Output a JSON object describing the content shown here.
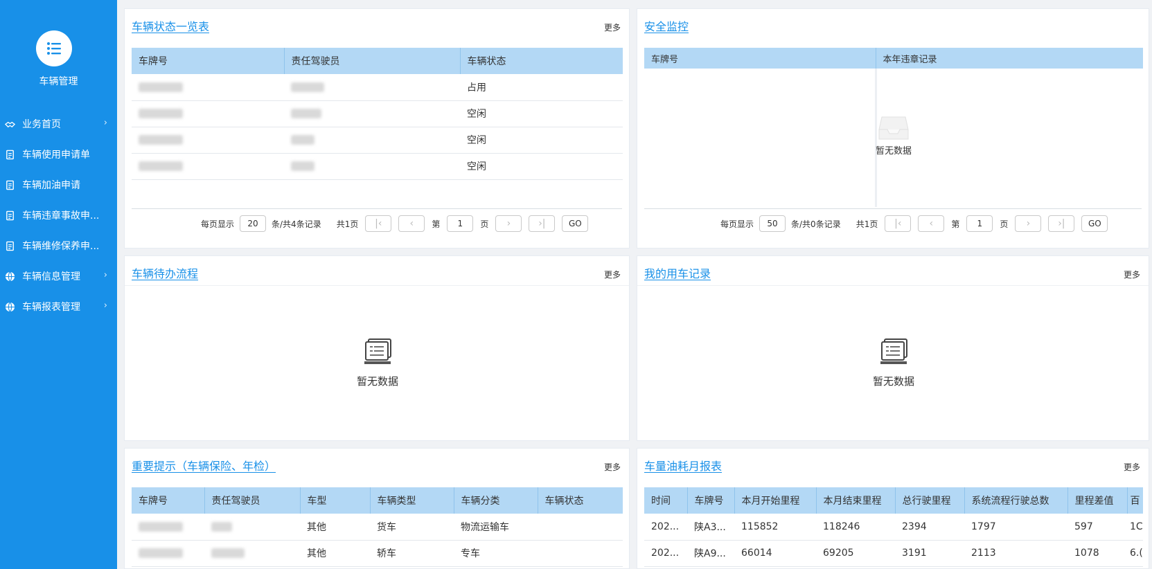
{
  "sidebar": {
    "title": "车辆管理",
    "items": [
      {
        "icon": "handshake-icon",
        "label": "业务首页",
        "has_children": true
      },
      {
        "icon": "document-icon",
        "label": "车辆使用申请单",
        "has_children": false
      },
      {
        "icon": "document-icon",
        "label": "车辆加油申请",
        "has_children": false
      },
      {
        "icon": "document-icon",
        "label": "车辆违章事故申...",
        "has_children": false
      },
      {
        "icon": "document-icon",
        "label": "车辆维修保养申...",
        "has_children": false
      },
      {
        "icon": "globe-icon",
        "label": "车辆信息管理",
        "has_children": true
      },
      {
        "icon": "globe-icon",
        "label": "车辆报表管理",
        "has_children": true
      }
    ]
  },
  "status_panel": {
    "title": "车辆状态一览表",
    "more": "更多",
    "columns": [
      "车牌号",
      "责任驾驶员",
      "车辆状态"
    ],
    "rows": [
      {
        "status": "占用"
      },
      {
        "status": "空闲"
      },
      {
        "status": "空闲"
      },
      {
        "status": "空闲"
      }
    ],
    "pager": {
      "per_page_label": "每页显示",
      "per_page": "20",
      "summary": "条/共4条记录",
      "pages": "共1页",
      "page_prefix": "第",
      "page": "1",
      "page_suffix": "页",
      "go": "GO"
    }
  },
  "safety_panel": {
    "title": "安全监控",
    "columns": [
      "车牌号",
      "本年违章记录"
    ],
    "empty": "暂无数据",
    "pager": {
      "per_page_label": "每页显示",
      "per_page": "50",
      "summary": "条/共0条记录",
      "pages": "共1页",
      "page_prefix": "第",
      "page": "1",
      "page_suffix": "页",
      "go": "GO"
    }
  },
  "todo_panel": {
    "title": "车辆待办流程",
    "more": "更多",
    "empty": "暂无数据"
  },
  "usage_panel": {
    "title": "我的用车记录",
    "more": "更多",
    "empty": "暂无数据"
  },
  "notice_panel": {
    "title": "重要提示（车辆保险、年检）",
    "more": "更多",
    "columns": [
      "车牌号",
      "责任驾驶员",
      "车型",
      "车辆类型",
      "车辆分类",
      "车辆状态"
    ],
    "rows": [
      {
        "model": "其他",
        "type": "货车",
        "category": "物流运输车",
        "status": ""
      },
      {
        "model": "其他",
        "type": "轿车",
        "category": "专车",
        "status": ""
      }
    ]
  },
  "fuel_panel": {
    "title": "车量油耗月报表",
    "more": "更多",
    "columns": [
      "时间",
      "车牌号",
      "本月开始里程",
      "本月结束里程",
      "总行驶里程",
      "系统流程行驶总数",
      "里程差值",
      "百"
    ],
    "rows": [
      {
        "time": "202...",
        "plate": "陕A3...",
        "start": "115852",
        "end": "118246",
        "total": "2394",
        "system": "1797",
        "diff": "597",
        "per100": "1C"
      },
      {
        "time": "202...",
        "plate": "陕A9...",
        "start": "66014",
        "end": "69205",
        "total": "3191",
        "system": "2113",
        "diff": "1078",
        "per100": "6.("
      }
    ]
  }
}
